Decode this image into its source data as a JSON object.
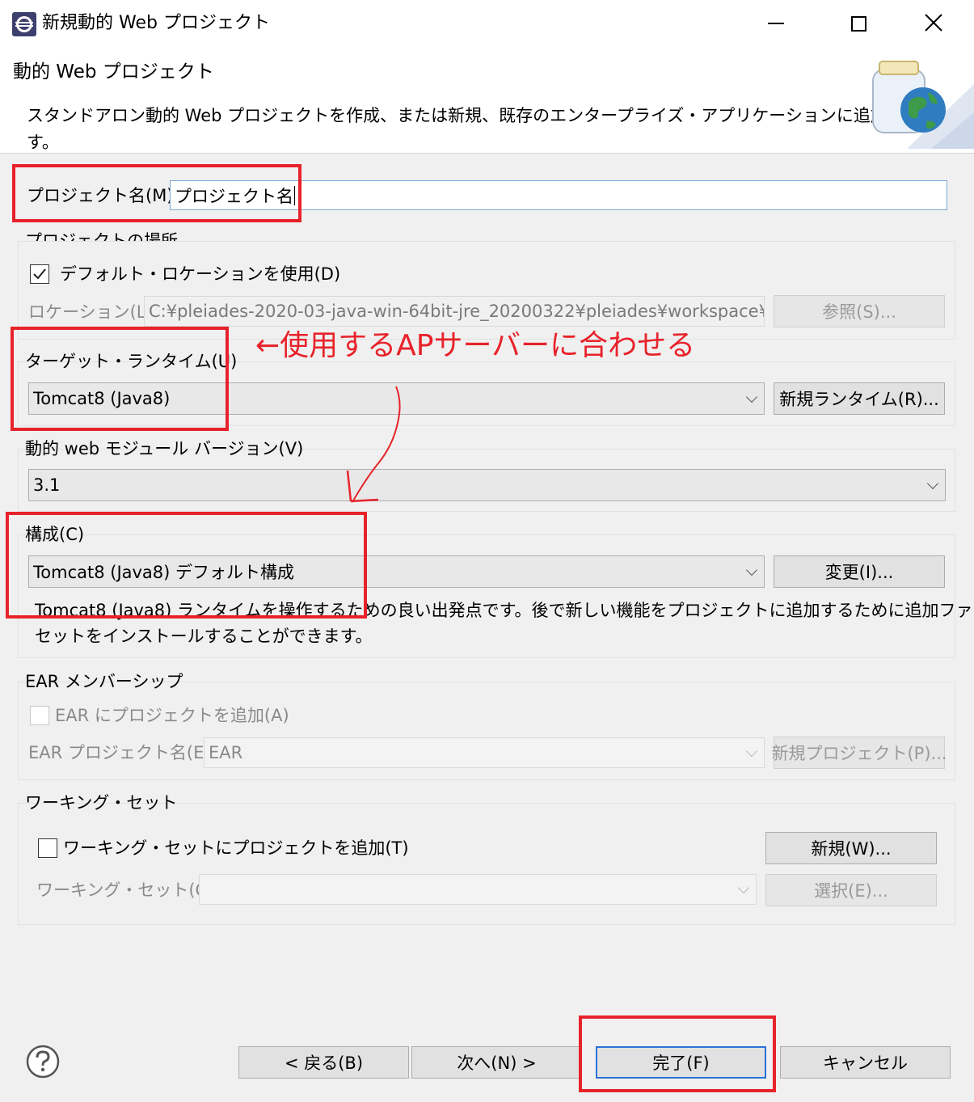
{
  "window": {
    "title": "新規動的 Web プロジェクト",
    "icon": "eclipse-icon"
  },
  "banner": {
    "heading": "動的 Web プロジェクト",
    "description_line1": "スタンドアロン動的 Web プロジェクトを作成、または新規、既存のエンタープライズ・アプリケーションに追加しま",
    "description_line2": "す。",
    "image": "jar-globe-icon"
  },
  "project_name": {
    "label": "プロジェクト名(M):",
    "value": "プロジェクト名"
  },
  "location": {
    "group_label": "プロジェクトの場所",
    "use_default_label": "デフォルト・ロケーションを使用(D)",
    "use_default_checked": true,
    "location_label": "ロケーション(L):",
    "location_value": "C:¥pleiades-2020-03-java-win-64bit-jre_20200322¥pleiades¥workspace¥",
    "browse_button": "参照(S)..."
  },
  "annotation": {
    "text": "←使用するAPサーバーに合わせる",
    "color": "#e8222a"
  },
  "target_runtime": {
    "label": "ターゲット・ランタイム(U)",
    "value": "Tomcat8 (Java8)",
    "new_button": "新規ランタイム(R)..."
  },
  "module_version": {
    "label": "動的 web モジュール バージョン(V)",
    "value": "3.1"
  },
  "configuration": {
    "label": "構成(C)",
    "value": "Tomcat8 (Java8) デフォルト構成",
    "modify_button": "変更(I)...",
    "description_line1": "Tomcat8 (Java8) ランタイムを操作するための良い出発点です。後で新しい機能をプロジェクトに追加するために追加ファ",
    "description_line2": "セットをインストールすることができます。"
  },
  "ear": {
    "group_label": "EAR メンバーシップ",
    "add_label": "EAR にプロジェクトを追加(A)",
    "add_checked": false,
    "name_label": "EAR プロジェクト名(E):",
    "name_value": "EAR",
    "new_button": "新規プロジェクト(P)..."
  },
  "working_set": {
    "group_label": "ワーキング・セット",
    "add_label": "ワーキング・セットにプロジェクトを追加(T)",
    "add_checked": false,
    "new_button": "新規(W)...",
    "sets_label": "ワーキング・セット(O):",
    "sets_value": "",
    "select_button": "選択(E)..."
  },
  "footer": {
    "help_icon": "help-icon",
    "back_button": "< 戻る(B)",
    "next_button": "次へ(N) >",
    "finish_button": "完了(F)",
    "cancel_button": "キャンセル"
  }
}
